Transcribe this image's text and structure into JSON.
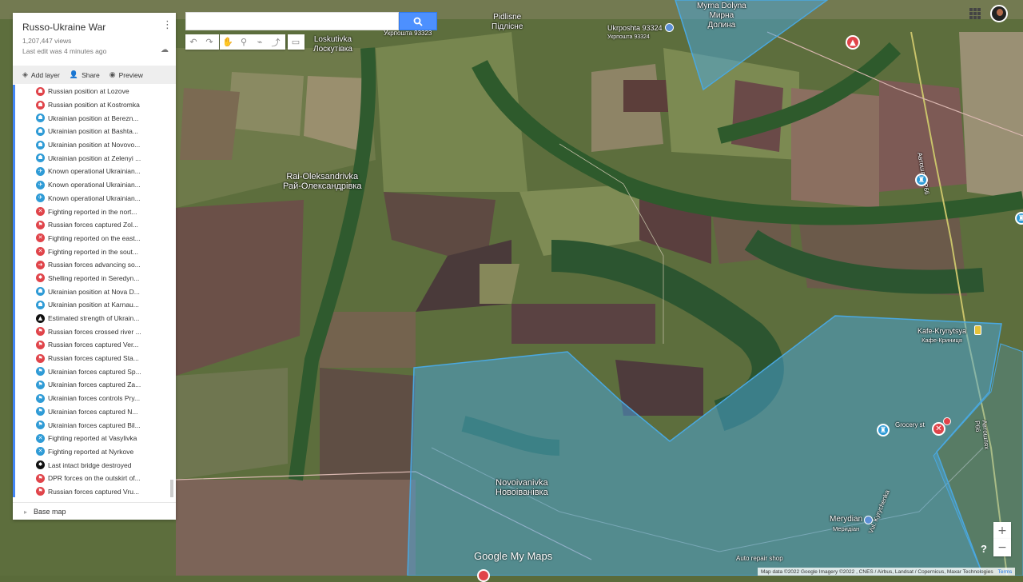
{
  "map": {
    "places": {
      "pidlisne": [
        "Pidlisne",
        "Підлісне"
      ],
      "loskutivka": [
        "Loskutivka",
        "Лоскутівка"
      ],
      "ukrposhta_left": "Укрпошта 93323",
      "ukrposhta_right": [
        "Ukrposhta 93324",
        "Укрпошта 93324"
      ],
      "myrna": [
        "Myrna Dolyna",
        "Мирна",
        "Долина"
      ],
      "rai": [
        "Rai-Oleksandrivka",
        "Рай-Олександрівка"
      ],
      "kafe": [
        "Kafe-Krynytsya",
        "Кафе-Криниця"
      ],
      "grocery": "Grocery st",
      "novoivanivka": [
        "Novoivanivka",
        "Новоіванівка"
      ],
      "merydian": [
        "Merydian",
        "Меридіан"
      ],
      "auto_repair": "Auto repair shop",
      "road_right": "Автошлях Р66",
      "road_bottom": "Vul. Kyrychenka"
    },
    "zone_color": "#4aa8e0",
    "russian_color": "#e0444a"
  },
  "search": {
    "value": ""
  },
  "toolbar_tools": [
    "undo-icon",
    "redo-icon",
    "hand-icon",
    "marker-icon",
    "line-icon",
    "route-icon",
    "ruler-icon"
  ],
  "panel": {
    "title": "Russo-Ukraine War",
    "views": "1,207,447 views",
    "last_edit": "Last edit was 4 minutes ago",
    "add_layer": "Add layer",
    "share": "Share",
    "preview": "Preview",
    "base_map": "Base map",
    "items": [
      {
        "label": "Russian position at Lozove",
        "color": "#e0444a",
        "icon": "person-icon",
        "glyph": "☗"
      },
      {
        "label": "Russian position at Kostromka",
        "color": "#e0444a",
        "icon": "person-icon",
        "glyph": "☗"
      },
      {
        "label": "Ukrainian position at Berezn...",
        "color": "#2f9bd6",
        "icon": "person-icon",
        "glyph": "☗"
      },
      {
        "label": "Ukrainian position at Bashta...",
        "color": "#2f9bd6",
        "icon": "person-icon",
        "glyph": "☗"
      },
      {
        "label": "Ukrainian position at Novovo...",
        "color": "#2f9bd6",
        "icon": "person-icon",
        "glyph": "☗"
      },
      {
        "label": "Ukrainian position at Zelenyi ...",
        "color": "#2f9bd6",
        "icon": "person-icon",
        "glyph": "☗"
      },
      {
        "label": "Known operational Ukrainian...",
        "color": "#2f9bd6",
        "icon": "airplane-icon",
        "glyph": "✈"
      },
      {
        "label": "Known operational Ukrainian...",
        "color": "#2f9bd6",
        "icon": "airplane-icon",
        "glyph": "✈"
      },
      {
        "label": "Known operational Ukrainian...",
        "color": "#2f9bd6",
        "icon": "airplane-icon",
        "glyph": "✈"
      },
      {
        "label": "Fighting reported in the nort...",
        "color": "#e0444a",
        "icon": "crossed-swords-icon",
        "glyph": "✕"
      },
      {
        "label": "Russian forces captured Zol...",
        "color": "#e0444a",
        "icon": "flag-icon",
        "glyph": "⚑"
      },
      {
        "label": "Fighting reported on the east...",
        "color": "#e0444a",
        "icon": "crossed-swords-icon",
        "glyph": "✕"
      },
      {
        "label": "Fighting reported in the sout...",
        "color": "#e0444a",
        "icon": "crossed-swords-icon",
        "glyph": "✕"
      },
      {
        "label": "Russian forces advancing so...",
        "color": "#e0444a",
        "icon": "arrow-icon",
        "glyph": "➜"
      },
      {
        "label": "Shelling reported in Seredyn...",
        "color": "#e0444a",
        "icon": "explosion-icon",
        "glyph": "✸"
      },
      {
        "label": "Ukrainian position at Nova D...",
        "color": "#2f9bd6",
        "icon": "person-icon",
        "glyph": "☗"
      },
      {
        "label": "Ukrainian position at Karnau...",
        "color": "#2f9bd6",
        "icon": "person-icon",
        "glyph": "☗"
      },
      {
        "label": "Estimated strength of Ukrain...",
        "color": "#111111",
        "icon": "warning-icon",
        "glyph": "▲"
      },
      {
        "label": "Russian forces crossed river ...",
        "color": "#e0444a",
        "icon": "flag-icon",
        "glyph": "⚑"
      },
      {
        "label": "Russian forces captured Ver...",
        "color": "#e0444a",
        "icon": "flag-icon",
        "glyph": "⚑"
      },
      {
        "label": "Russian forces captured Sta...",
        "color": "#e0444a",
        "icon": "flag-icon",
        "glyph": "⚑"
      },
      {
        "label": "Ukrainian forces captured Sp...",
        "color": "#2f9bd6",
        "icon": "flag-icon",
        "glyph": "⚑"
      },
      {
        "label": "Ukrainian forces captured Za...",
        "color": "#2f9bd6",
        "icon": "flag-icon",
        "glyph": "⚑"
      },
      {
        "label": "Ukrainian forces controls Pry...",
        "color": "#2f9bd6",
        "icon": "flag-icon",
        "glyph": "⚑"
      },
      {
        "label": "Ukrainian forces captured N...",
        "color": "#2f9bd6",
        "icon": "flag-icon",
        "glyph": "⚑"
      },
      {
        "label": "Ukrainian forces captured Bil...",
        "color": "#2f9bd6",
        "icon": "flag-icon",
        "glyph": "⚑"
      },
      {
        "label": "Fighting reported at Vasylivka",
        "color": "#2f9bd6",
        "icon": "crossed-swords-icon",
        "glyph": "✕"
      },
      {
        "label": "Fighting reported at Nyrkove",
        "color": "#2f9bd6",
        "icon": "crossed-swords-icon",
        "glyph": "✕"
      },
      {
        "label": "Last intact bridge destroyed",
        "color": "#111111",
        "icon": "explosion-icon",
        "glyph": "✸"
      },
      {
        "label": "DPR forces on the outskirt of...",
        "color": "#e0444a",
        "icon": "flag-icon",
        "glyph": "⚑"
      },
      {
        "label": "Russian forces captured Vru...",
        "color": "#e0444a",
        "icon": "flag-icon",
        "glyph": "⚑"
      }
    ]
  },
  "logo": "Google My Maps",
  "attribution": "Map data ©2022 Google Imagery ©2022 , CNES / Airbus, Landsat / Copernicus, Maxar Technologies",
  "terms": "Terms",
  "zoom_in": "+",
  "zoom_out": "−",
  "help": "?"
}
